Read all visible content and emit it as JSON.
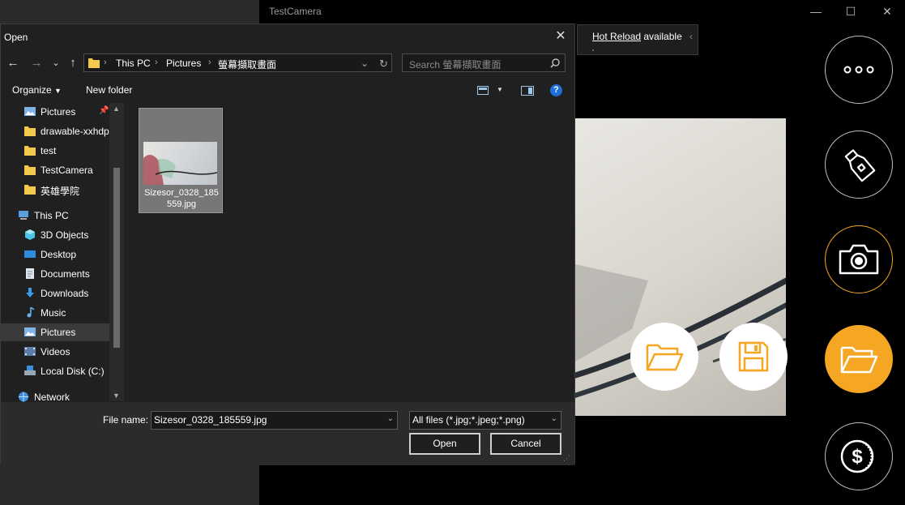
{
  "app": {
    "title": "TestCamera",
    "window_controls": {
      "minimize": "—",
      "maximize": "☐",
      "close": "✕"
    },
    "hot_reload": {
      "link": "Hot Reload",
      "suffix": " available"
    }
  },
  "dialog": {
    "title": "Open",
    "close": "✕",
    "nav": {
      "back": "←",
      "forward": "→",
      "recent": "⌄",
      "up": "↑"
    },
    "address": {
      "crumbs": [
        "This PC",
        "Pictures",
        "螢幕擷取畫面"
      ]
    },
    "search_placeholder": "Search 螢幕擷取畫面",
    "toolbar": {
      "organize": "Organize",
      "new_folder": "New folder",
      "help": "?"
    },
    "nav_pane": {
      "quick_access": [
        {
          "label": "Pictures",
          "icon": "pictures-icon",
          "pinned": true
        },
        {
          "label": "drawable-xxhdp",
          "icon": "folder-icon"
        },
        {
          "label": "test",
          "icon": "folder-icon"
        },
        {
          "label": "TestCamera",
          "icon": "folder-icon"
        },
        {
          "label": "英雄學院",
          "icon": "folder-icon"
        }
      ],
      "this_pc": "This PC",
      "this_pc_items": [
        {
          "label": "3D Objects",
          "icon": "3d-objects-icon"
        },
        {
          "label": "Desktop",
          "icon": "desktop-icon"
        },
        {
          "label": "Documents",
          "icon": "documents-icon"
        },
        {
          "label": "Downloads",
          "icon": "downloads-icon"
        },
        {
          "label": "Music",
          "icon": "music-icon"
        },
        {
          "label": "Pictures",
          "icon": "pictures-icon",
          "selected": true
        },
        {
          "label": "Videos",
          "icon": "videos-icon"
        },
        {
          "label": "Local Disk (C:)",
          "icon": "drive-icon"
        }
      ],
      "network": "Network"
    },
    "files": [
      {
        "name": "Sizesor_0328_185559.jpg"
      }
    ],
    "file_name_label": "File name:",
    "file_name_value": "Sizesor_0328_185559.jpg",
    "file_type_value": "All files (*.jpg;*.jpeg;*.png)",
    "open_button": "Open",
    "cancel_button": "Cancel"
  },
  "colors": {
    "accent_orange": "#F5A623",
    "dark_bg": "#202020"
  }
}
